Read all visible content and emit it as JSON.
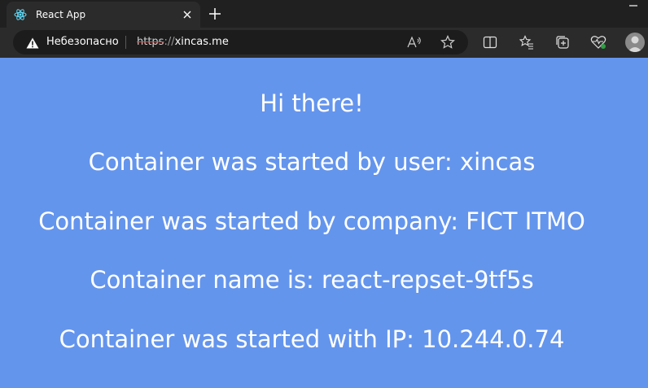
{
  "tab": {
    "title": "React App",
    "favicon": "react-icon"
  },
  "window": {
    "controls": [
      "minimize-icon"
    ]
  },
  "address_bar": {
    "security_label": "Небезопасно",
    "url_scheme": "https",
    "url_separator": "://",
    "url_host": "xincas.me"
  },
  "toolbar": {
    "icons": [
      "read-aloud-icon",
      "favorite-star-icon",
      "split-screen-icon",
      "favorites-icon",
      "collections-icon",
      "browser-essentials-icon",
      "profile-avatar"
    ]
  },
  "page": {
    "background_color": "#6495ed",
    "text_color": "#ffffff",
    "lines": [
      "Hi there!",
      "Container was started by user: xincas",
      "Container was started by company: FICT ITMO",
      "Container name is: react-repset-9tf5s",
      "Container was started with IP: 10.244.0.74"
    ]
  }
}
